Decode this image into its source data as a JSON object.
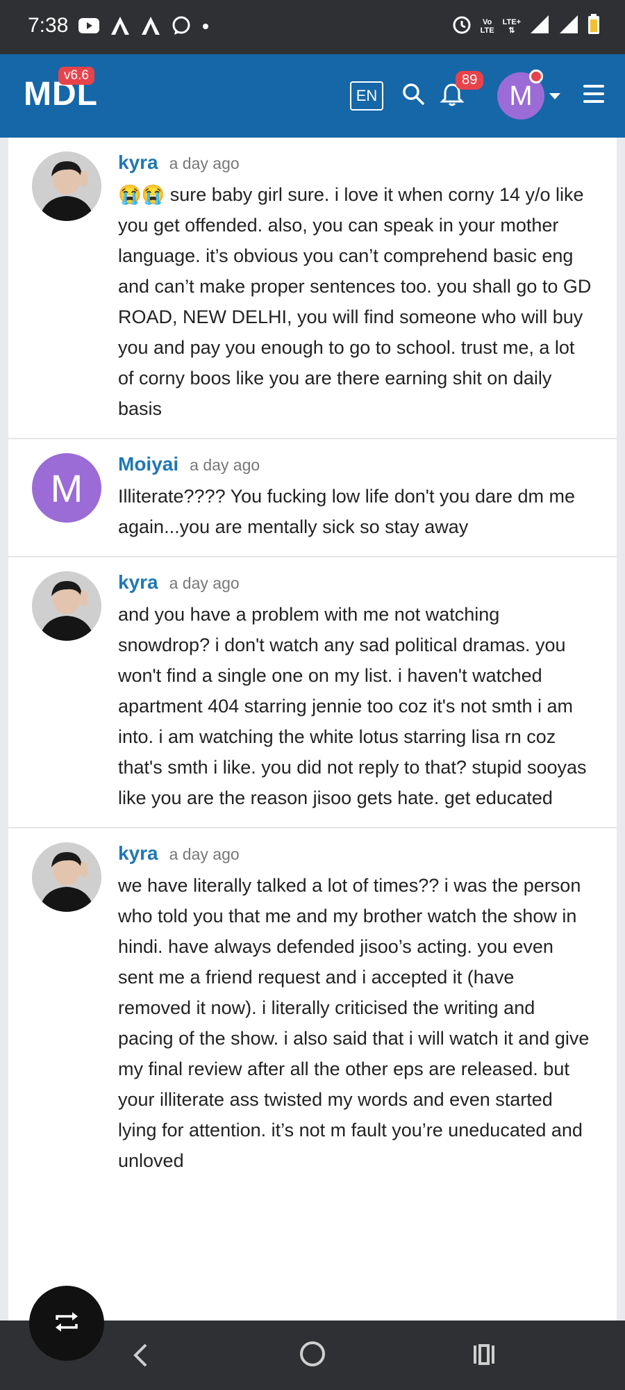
{
  "status_bar": {
    "time": "7:38",
    "network_label_top": "Vo",
    "network_label_bottom": "LTE",
    "lte_label": "LTE+"
  },
  "header": {
    "logo": "MDL",
    "version": "v6.6",
    "language": "EN",
    "notification_count": "89",
    "user_initial": "M"
  },
  "comments": [
    {
      "author": "kyra",
      "time": "a day ago",
      "avatar_type": "photo",
      "text": "😭😭 sure baby girl sure. i love it when corny 14 y/o like you get offended. also, you can speak in your mother language. it’s obvious you can’t comprehend basic eng and can’t make proper sentences too. you shall go to GD ROAD, NEW DELHI, you will find someone who will buy you and pay you enough to go to school. trust me, a lot of corny boos like you are there earning shit on daily basis"
    },
    {
      "author": "Moiyai",
      "time": "a day ago",
      "avatar_type": "letter",
      "avatar_letter": "M",
      "text": "Illiterate???? You fucking low life don't you dare dm me again...you are mentally sick so stay away"
    },
    {
      "author": "kyra",
      "time": "a day ago",
      "avatar_type": "photo",
      "text": "and you have a problem with me not watching snowdrop? i don't watch any sad political dramas. you won't find a single one on my list. i haven't watched apartment 404 starring jennie too coz it's not smth i am into. i am watching the white lotus starring lisa rn coz that's smth i like. you did not reply to that? stupid sooyas like you are the reason jisoo gets hate. get educated"
    },
    {
      "author": "kyra",
      "time": "a day ago",
      "avatar_type": "photo",
      "text": "we have literally talked a lot of times?? i was the person who told you that me and my brother watch the show in hindi. have always defended jisoo’s acting. you even sent me a friend request and i accepted it (have removed it now). i literally criticised the writing and pacing of the show. i also said that i will watch it and give my final review after all the other eps are released. but your illiterate ass twisted my words and even started lying for attention. it’s not m fault you’re uneducated and unloved"
    }
  ],
  "colors": {
    "header_bg": "#1567a8",
    "status_bg": "#2f3033",
    "badge_red": "#e7434b",
    "avatar_purple": "#9b6bd6",
    "author_blue": "#1f77b4"
  },
  "icons": {
    "youtube": "youtube-icon",
    "alarm": "alarm-icon",
    "signal": "signal-icon",
    "battery": "battery-icon",
    "search": "search-icon",
    "bell": "bell-icon",
    "menu": "menu-icon",
    "repost": "repost-icon",
    "back": "back-icon",
    "home": "home-icon",
    "recents": "recents-icon"
  }
}
